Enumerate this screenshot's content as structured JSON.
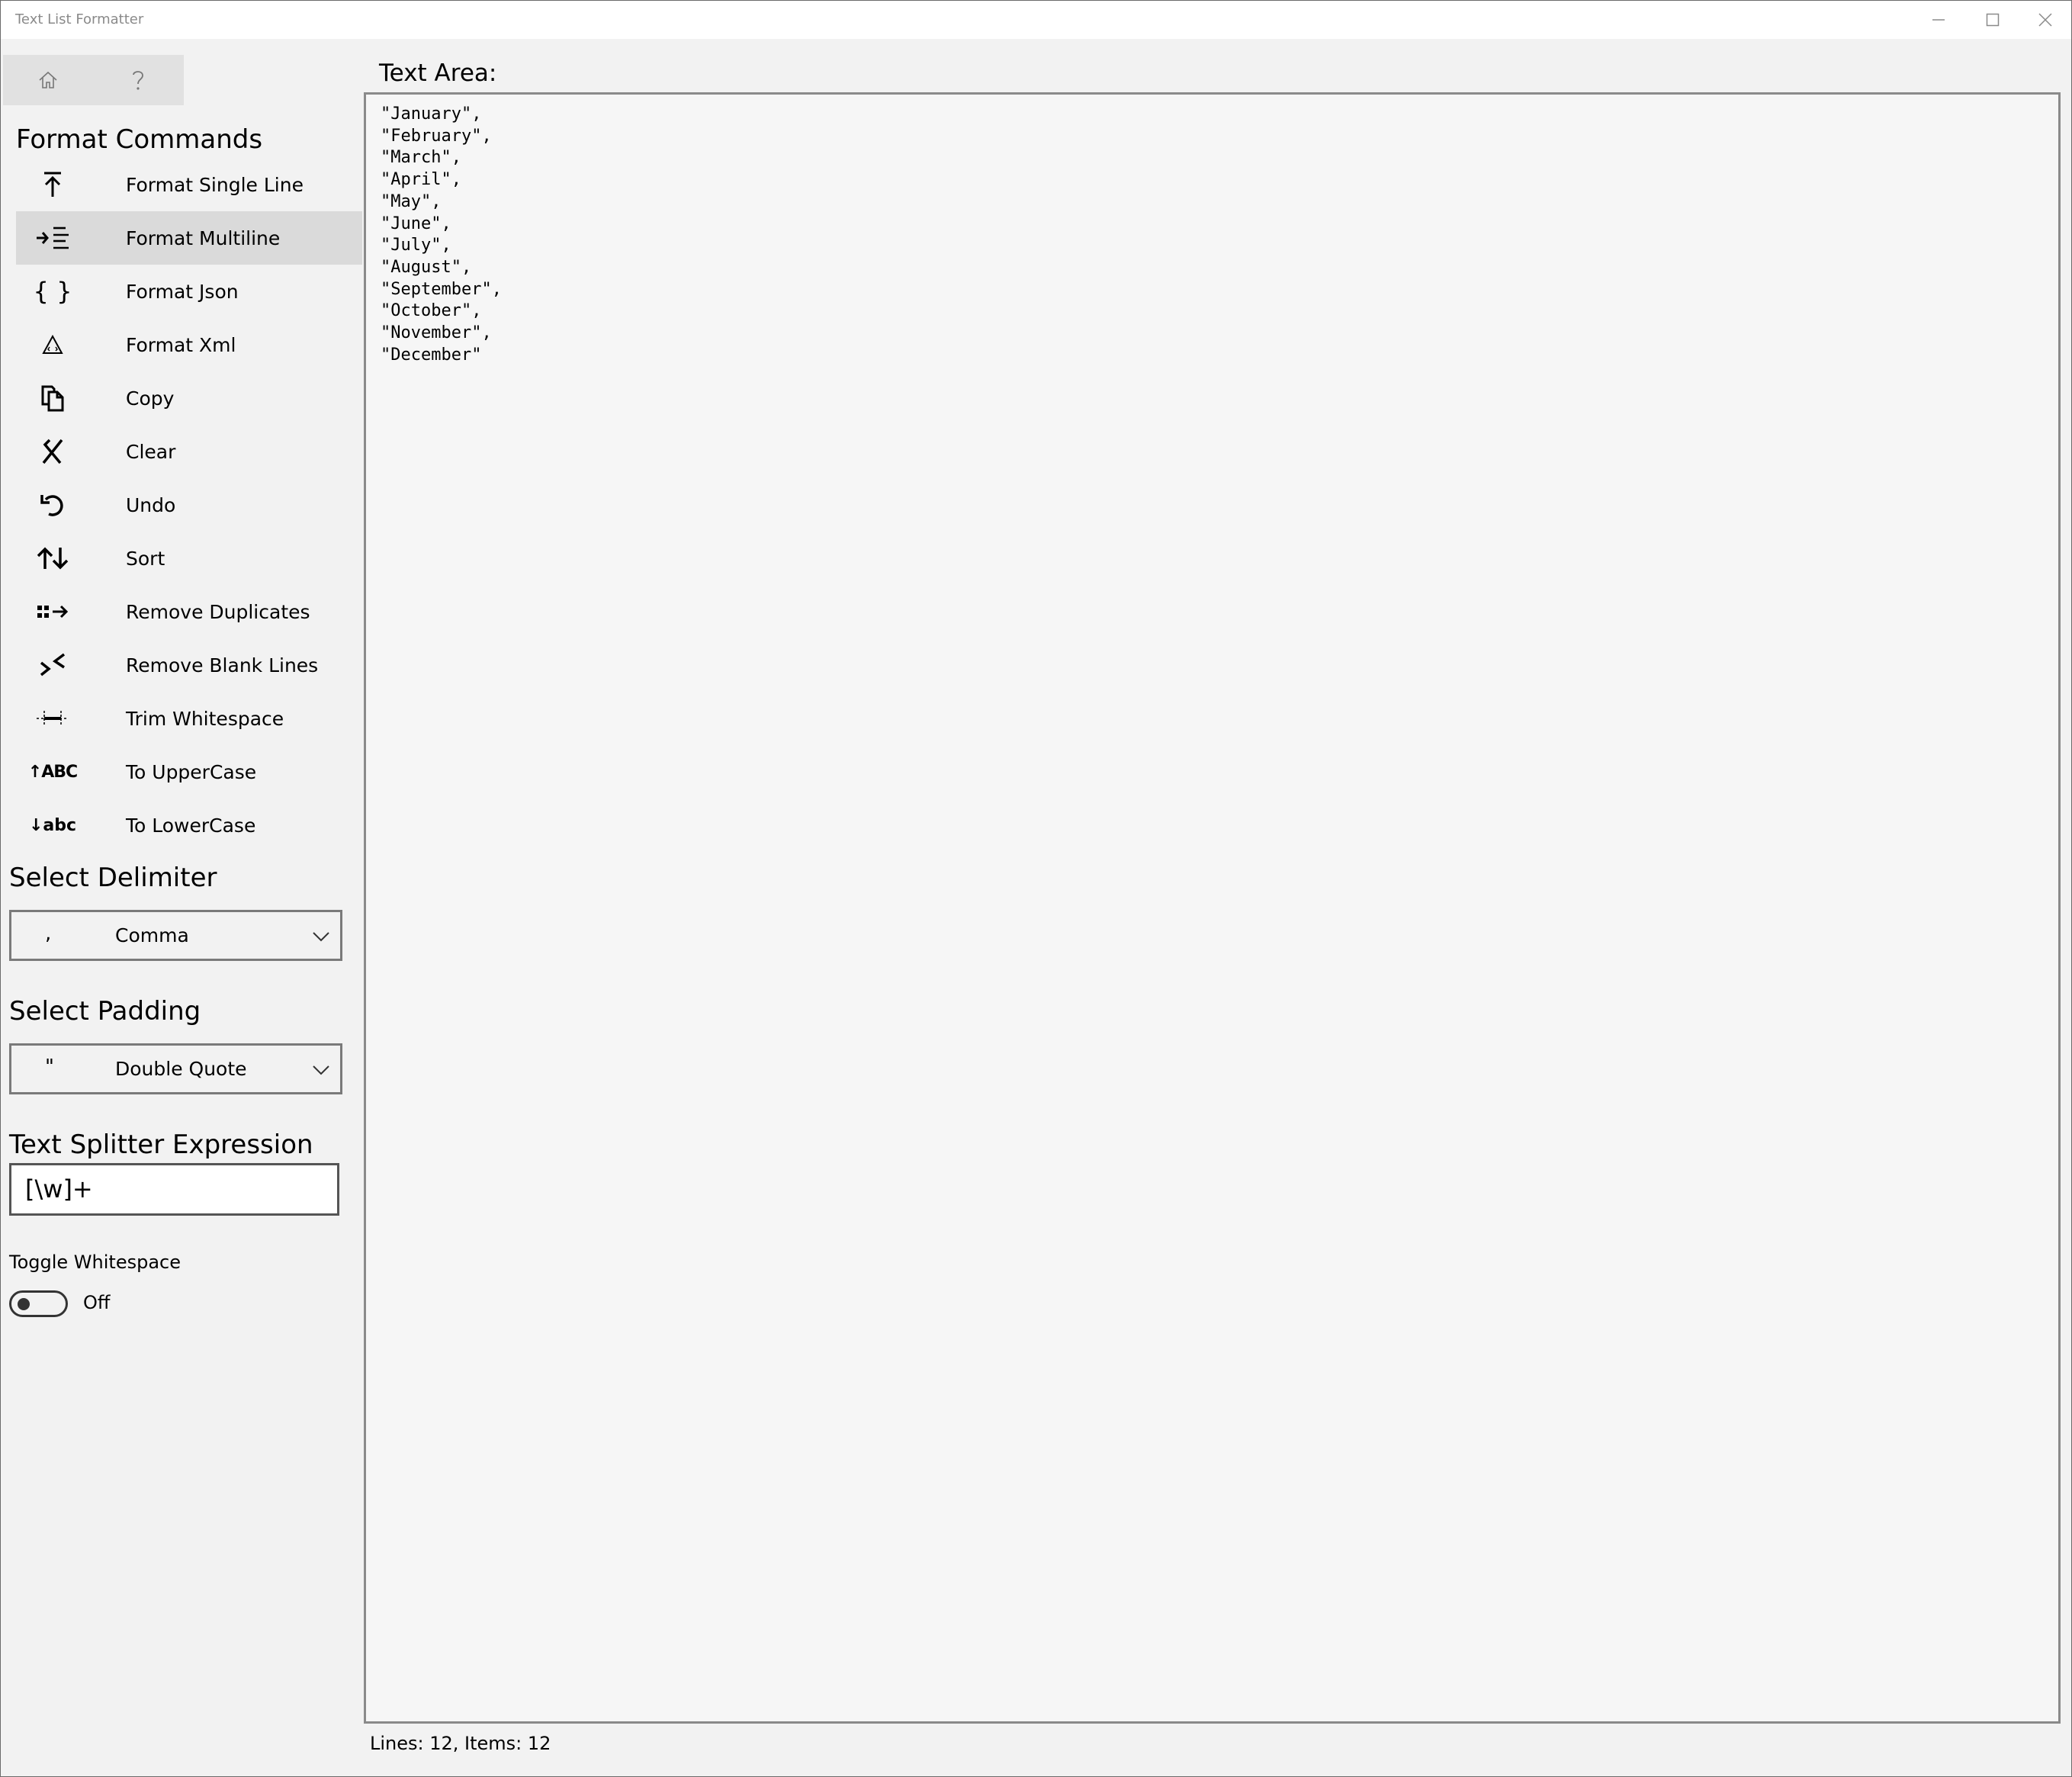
{
  "window": {
    "title": "Text List Formatter"
  },
  "nav": {
    "home_icon": "home-icon",
    "help_icon": "help-icon"
  },
  "sidebar": {
    "commands_heading": "Format Commands",
    "commands": [
      {
        "label": "Format Single Line",
        "icon": "arrow-to-top-icon"
      },
      {
        "label": "Format Multiline",
        "icon": "indent-icon",
        "selected": true
      },
      {
        "label": "Format Json",
        "icon": "braces-icon"
      },
      {
        "label": "Format Xml",
        "icon": "xml-triangle-icon"
      },
      {
        "label": "Copy",
        "icon": "copy-icon"
      },
      {
        "label": "Clear",
        "icon": "clear-icon"
      },
      {
        "label": "Undo",
        "icon": "undo-icon"
      },
      {
        "label": "Sort",
        "icon": "sort-icon"
      },
      {
        "label": "Remove Duplicates",
        "icon": "remove-duplicates-icon"
      },
      {
        "label": "Remove Blank Lines",
        "icon": "remove-blank-lines-icon"
      },
      {
        "label": "Trim Whitespace",
        "icon": "trim-icon"
      },
      {
        "label": "To UpperCase",
        "icon": "uppercase-icon",
        "glyph": "ABC"
      },
      {
        "label": "To LowerCase",
        "icon": "lowercase-icon",
        "glyph": "abc"
      }
    ],
    "delimiter_heading": "Select Delimiter",
    "delimiter": {
      "symbol": ",",
      "value": "Comma"
    },
    "padding_heading": "Select Padding",
    "padding": {
      "symbol": "\"",
      "value": "Double Quote"
    },
    "splitter_heading": "Text Splitter Expression",
    "splitter_value": "[\\w]+",
    "toggle_label": "Toggle Whitespace",
    "toggle_state": "Off"
  },
  "main": {
    "text_area_label": "Text Area:",
    "text_content": "\"January\",\n\"February\",\n\"March\",\n\"April\",\n\"May\",\n\"June\",\n\"July\",\n\"August\",\n\"September\",\n\"October\",\n\"November\",\n\"December\"",
    "status": "Lines: 12, Items: 12"
  }
}
